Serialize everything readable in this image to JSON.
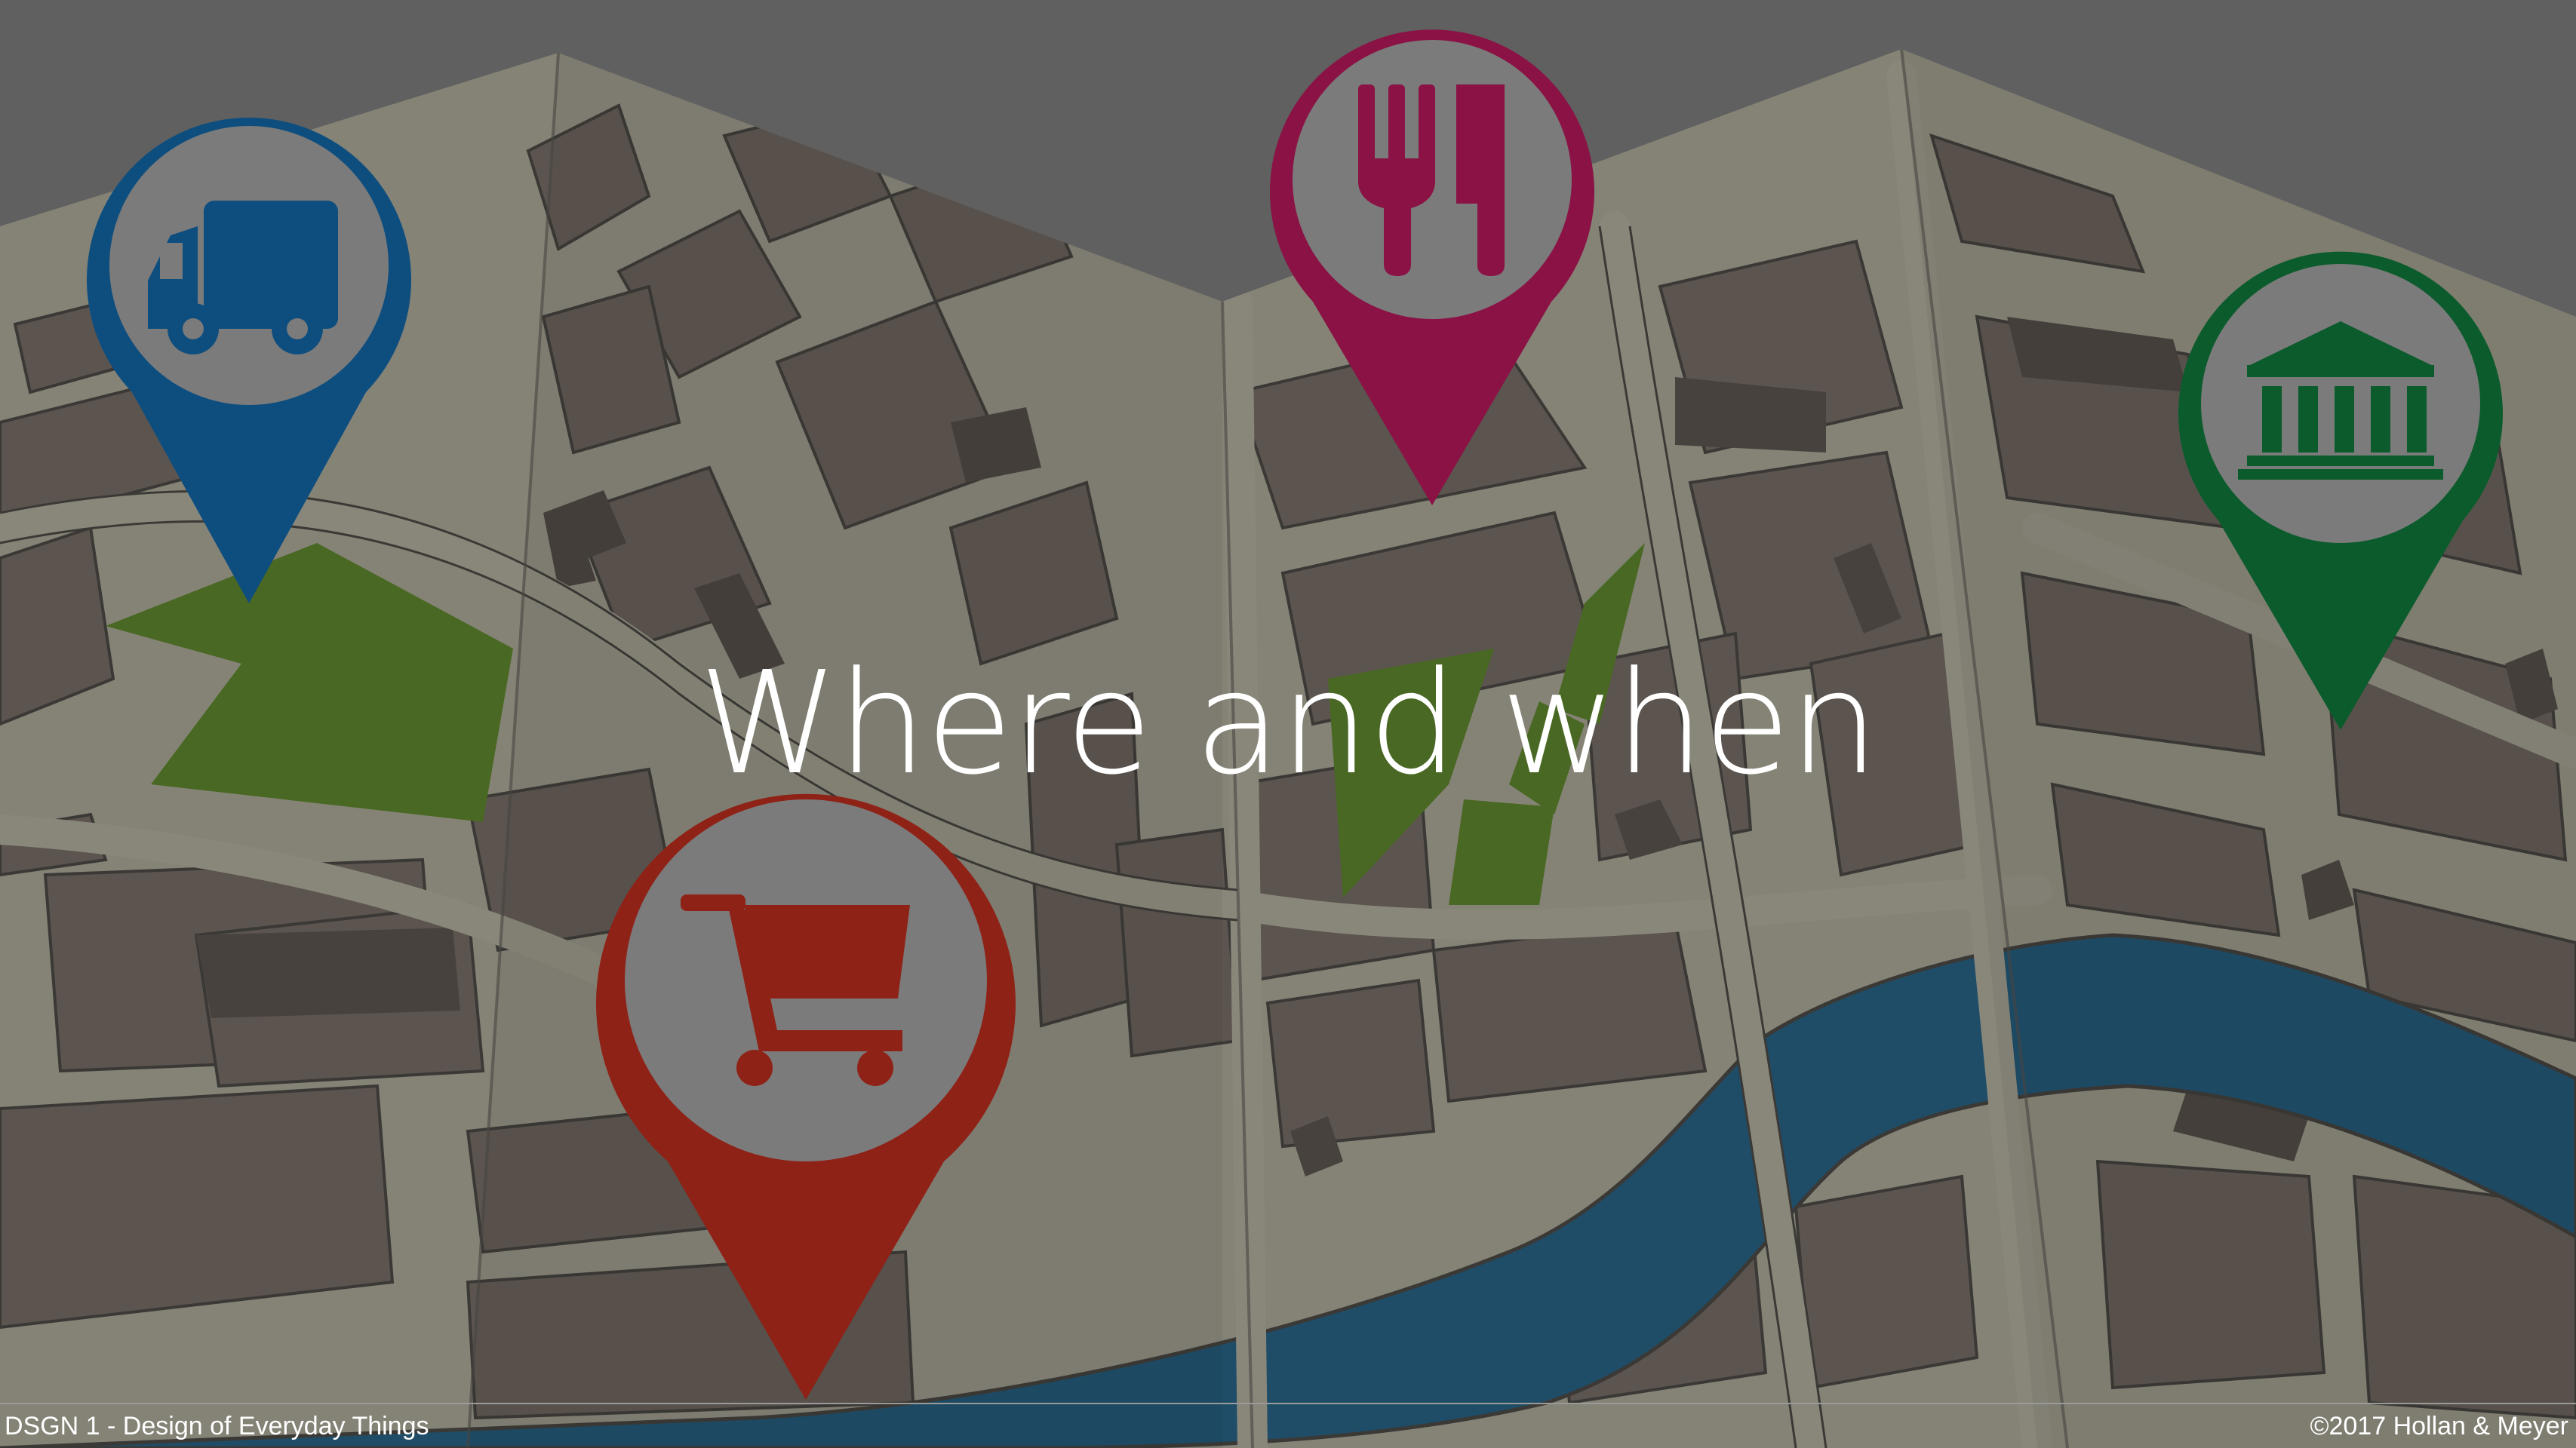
{
  "slide": {
    "title": "Where and when"
  },
  "footer": {
    "left_text": "DSGN 1 - Design of Everyday Things",
    "right_text": "©2017 Hollan & Meyer"
  },
  "pins": [
    {
      "icon": "truck-icon",
      "color": "#0e4e7f"
    },
    {
      "icon": "fork-knife-icon",
      "color": "#8a1245"
    },
    {
      "icon": "museum-icon",
      "color": "#0c5b2c"
    },
    {
      "icon": "shopping-cart-icon",
      "color": "#8f2217"
    }
  ],
  "colors": {
    "overlay": "#6f6f6f",
    "block": "#6a5f58",
    "street": "#a8a593",
    "park": "#4f7a1b",
    "river": "#16557a"
  }
}
